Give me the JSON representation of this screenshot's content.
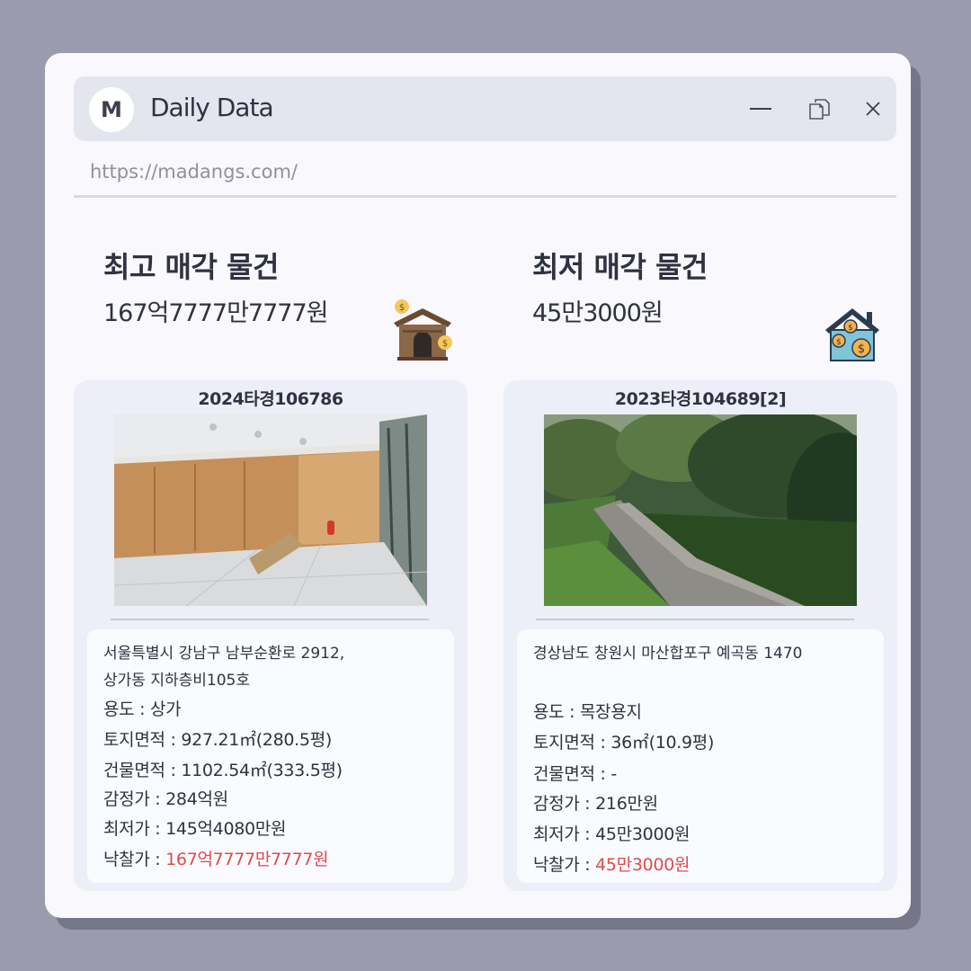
{
  "window": {
    "logo_letter": "M",
    "title": "Daily Data",
    "url": "https://madangs.com/"
  },
  "left": {
    "heading": "최고 매각 물건",
    "price": "167억7777만7777원",
    "icon": "house-money-icon",
    "case_no": "2024타경106786",
    "address_line1": "서울특별시 강남구 남부순환로 2912,",
    "address_line2": "상가동 지하층비105호",
    "rows": [
      {
        "label": "용도 : ",
        "value": "상가"
      },
      {
        "label": "토지면적 : ",
        "value": "927.21㎡(280.5평)"
      },
      {
        "label": "건물면적 : ",
        "value": "1102.54㎡(333.5평)"
      },
      {
        "label": "감정가 : ",
        "value": "284억원"
      },
      {
        "label": "최저가 : ",
        "value": "145억4080만원"
      },
      {
        "label": "낙찰가 : ",
        "value": "167억7777만7777원"
      }
    ]
  },
  "right": {
    "heading": "최저 매각 물건",
    "price": "45만3000원",
    "icon": "house-coins-icon",
    "case_no": "2023타경104689[2]",
    "address_line1": "경상남도 창원시 마산합포구 예곡동 1470",
    "rows": [
      {
        "label": "용도 : ",
        "value": "목장용지"
      },
      {
        "label": "토지면적 : ",
        "value": "36㎡(10.9평)"
      },
      {
        "label": "건물면적 : ",
        "value": "-"
      },
      {
        "label": "감정가 : ",
        "value": "216만원"
      },
      {
        "label": "최저가 : ",
        "value": "45만3000원"
      },
      {
        "label": "낙찰가 : ",
        "value": "45만3000원"
      }
    ]
  },
  "colors": {
    "accent_red": "#e04a4a",
    "text": "#2f3240",
    "background": "#9a9cae"
  }
}
